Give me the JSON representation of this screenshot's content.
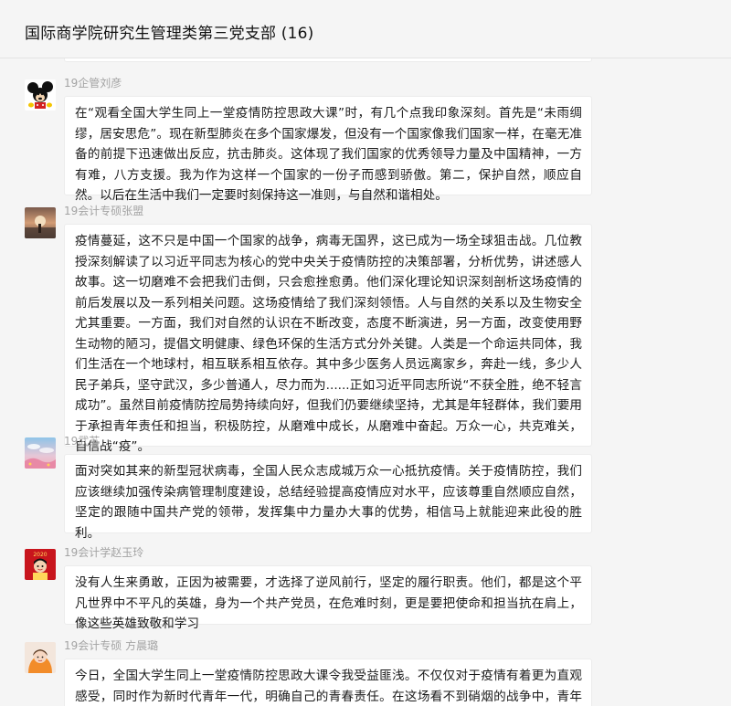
{
  "window": {
    "title": "国际商学院研究生管理类第三党支部 (16)"
  },
  "messages": [
    {
      "sender": "19企管刘彦",
      "avatar_icon": "mickey-mouse-avatar",
      "text": "在“观看全国大学生同上一堂疫情防控思政大课”时，有几个点我印象深刻。首先是“未雨绸缪，居安思危”。现在新型肺炎在多个国家爆发，但没有一个国家像我们国家一样，在毫无准备的前提下迅速做出反应，抗击肺炎。这体现了我们国家的优秀领导力量及中国精神，一方有难，八方支援。我为作为这样一个国家的一份子而感到骄傲。第二，保护自然，顺应自然。以后在生活中我们一定要时刻保持这一准则，与自然和谐相处。"
    },
    {
      "sender": "19会计专硕张盟",
      "avatar_icon": "sunset-photo-avatar",
      "text": "疫情蔓延，这不只是中国一个国家的战争，病毒无国界，这已成为一场全球狙击战。几位教授深刻解读了以习近平同志为核心的党中央关于疫情防控的决策部署，分析优势，讲述感人故事。这一切磨难不会把我们击倒，只会愈挫愈勇。他们深化理论知识深刻剖析这场疫情的前后发展以及一系列相关问题。这场疫情给了我们深刻领悟。人与自然的关系以及生物安全尤其重要。一方面，我们对自然的认识在不断改变，态度不断演进，另一方面，改变使用野生动物的陋习，提倡文明健康、绿色环保的生活方式分外关键。人类是一个命运共同体，我们生活在一个地球村，相互联系相互依存。其中多少医务人员远离家乡，奔赴一线，多少人民子弟兵，坚守武汉，多少普通人，尽力而为......正如习近平同志所说“不获全胜，绝不轻言成功”。虽然目前疫情防控局势持续向好，但我们仍要继续坚持，尤其是年轻群体，我们要用于承担青年责任和担当，积极防控，从磨难中成长，从磨难中奋起。万众一心，共克难关，自信战“疫”。"
    },
    {
      "sender": "19武苏",
      "avatar_icon": "sky-landscape-avatar",
      "text": "面对突如其来的新型冠状病毒，全国人民众志成城万众一心抵抗疫情。关于疫情防控，我们应该继续加强传染病管理制度建设，总结经验提高疫情应对水平，应该尊重自然顺应自然，坚定的跟随中国共产党的领带，发挥集中力量办大事的优势，相信马上就能迎来此役的胜利。"
    },
    {
      "sender": "19会计学赵玉玲",
      "avatar_icon": "new-year-2020-avatar",
      "text": "没有人生来勇敢，正因为被需要，才选择了逆风前行，坚定的履行职责。他们，都是这个平凡世界中不平凡的英雄，身为一个共产党员，在危难时刻，更是要把使命和担当抗在肩上，像这些英雄致敬和学习"
    },
    {
      "sender": "19会计专硕 方晨璐",
      "avatar_icon": "girl-photo-avatar",
      "text": "今日，全国大学生同上一堂疫情防控思政大课令我受益匪浅。不仅仅对于疫情有着更为直观感受，同时作为新时代青年一代，明确自己的青春责任。在这场看不到硝烟的战争中，青年一代一路成长，在逆行路上更要正直，但五五五年一线五面向您的一代春年干亡一面写就是大"
    }
  ]
}
